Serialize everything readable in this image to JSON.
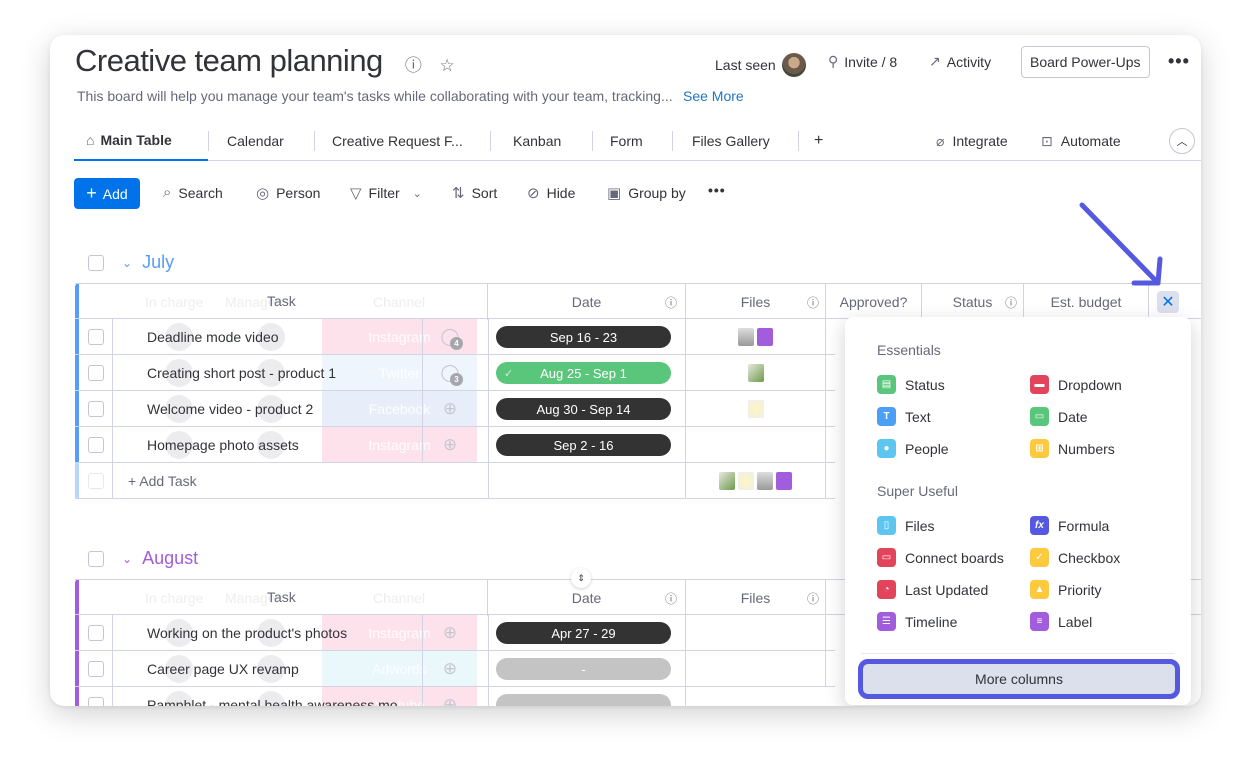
{
  "board": {
    "title": "Creative team planning",
    "description": "This board will help you manage your team's tasks while collaborating with your team, tracking...",
    "see_more": "See More",
    "last_seen": "Last seen",
    "invite": "Invite / 8",
    "activity": "Activity",
    "power_ups": "Board Power-Ups",
    "more": "•••"
  },
  "tabs": [
    {
      "label": "Main Table",
      "active": true
    },
    {
      "label": "Calendar"
    },
    {
      "label": "Creative Request F..."
    },
    {
      "label": "Kanban"
    },
    {
      "label": "Form"
    },
    {
      "label": "Files Gallery"
    },
    {
      "label": "+"
    }
  ],
  "tab_actions": {
    "integrate": "Integrate",
    "automate": "Automate"
  },
  "toolbar": {
    "add": "Add",
    "search": "Search",
    "person": "Person",
    "filter": "Filter",
    "sort": "Sort",
    "hide": "Hide",
    "group_by": "Group by",
    "more": "•••"
  },
  "columns": {
    "in_charge": "In charge",
    "manager": "Manager",
    "task": "Task",
    "channel": "Channel",
    "date": "Date",
    "files": "Files",
    "approved": "Approved?",
    "status": "Status",
    "est_budget": "Est. budget"
  },
  "groups": [
    {
      "name": "July",
      "color": "#579bfc",
      "rows": [
        {
          "task": "Deadline mode video",
          "channel": "Instagram",
          "channel_color": "#fde2ec",
          "updates": "4",
          "date": "Sep 16 - 23",
          "date_color": "#333333",
          "done": false
        },
        {
          "task": "Creating short post - product 1",
          "channel": "Twitter",
          "channel_color": "#eef5fd",
          "updates": "3",
          "date": "Aug 25 - Sep 1",
          "date_color": "#5ac67b",
          "done": true
        },
        {
          "task": "Welcome video - product 2",
          "channel": "Facebook",
          "channel_color": "#e7eef9",
          "updates": "",
          "date": "Aug 30 - Sep 14",
          "date_color": "#333333",
          "done": false
        },
        {
          "task": "Homepage photo assets",
          "channel": "Instagram",
          "channel_color": "#fde2ec",
          "updates": "",
          "date": "Sep 2 - 16",
          "date_color": "#333333",
          "done": false
        }
      ],
      "add_task": "+ Add Task"
    },
    {
      "name": "August",
      "color": "#a25ddc",
      "rows": [
        {
          "task": "Working on the product's photos",
          "channel": "Instagram",
          "channel_color": "#fde2ec",
          "date": "Apr 27 - 29",
          "date_color": "#333333"
        },
        {
          "task": "Career page UX revamp",
          "channel": "Adwords",
          "channel_color": "#eaf7fb",
          "date": "-",
          "date_color": "#c4c4c4"
        },
        {
          "task": "Pamphlet - mental health awareness mo...",
          "channel": "Youtube",
          "channel_color": "#fde2ec",
          "date": "-",
          "date_color": "#c4c4c4"
        }
      ]
    }
  ],
  "column_picker": {
    "essentials_label": "Essentials",
    "essentials": [
      {
        "label": "Status",
        "icon": "status-icon",
        "color": "#5ac67b"
      },
      {
        "label": "Dropdown",
        "icon": "dropdown-icon",
        "color": "#e2445c"
      },
      {
        "label": "Text",
        "icon": "text-icon",
        "color": "#4b9ff5"
      },
      {
        "label": "Date",
        "icon": "date-icon",
        "color": "#5ac67b"
      },
      {
        "label": "People",
        "icon": "people-icon",
        "color": "#5cc5f0"
      },
      {
        "label": "Numbers",
        "icon": "numbers-icon",
        "color": "#fdca3f"
      }
    ],
    "super_useful_label": "Super Useful",
    "super_useful": [
      {
        "label": "Files",
        "icon": "files-icon",
        "color": "#5cc5f0"
      },
      {
        "label": "Formula",
        "icon": "formula-icon",
        "color": "#5559df"
      },
      {
        "label": "Connect boards",
        "icon": "connect-boards-icon",
        "color": "#e2445c"
      },
      {
        "label": "Checkbox",
        "icon": "checkbox-icon",
        "color": "#fdca3f"
      },
      {
        "label": "Last Updated",
        "icon": "last-updated-icon",
        "color": "#e2445c"
      },
      {
        "label": "Priority",
        "icon": "priority-icon",
        "color": "#fdca3f"
      },
      {
        "label": "Timeline",
        "icon": "timeline-icon",
        "color": "#a25ddc"
      },
      {
        "label": "Label",
        "icon": "label-icon",
        "color": "#a25ddc"
      }
    ],
    "more_columns": "More columns"
  }
}
